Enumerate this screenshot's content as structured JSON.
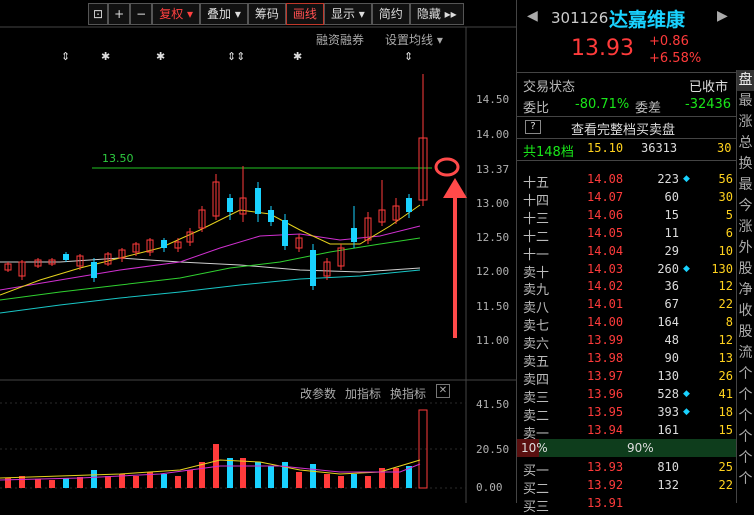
{
  "toolbar": {
    "buttons": [
      "复权",
      "叠加",
      "筹码",
      "画线",
      "显示",
      "简约",
      "隐藏"
    ],
    "collapse": "▸▸"
  },
  "chart_top": {
    "links": [
      "融资融券",
      "设置均线"
    ],
    "y_ticks": [
      "14.50",
      "14.00",
      "13.37",
      "13.00",
      "12.50",
      "12.00",
      "11.50",
      "11.00"
    ],
    "level_line_label": "13.50",
    "markers": [
      "⇕",
      "✱",
      "✱",
      "⇕⇕",
      "✱",
      "⇕"
    ]
  },
  "chart_bottom": {
    "links": [
      "改参数",
      "加指标",
      "换指标"
    ],
    "close_icon": "✕",
    "y_ticks": [
      "41.50",
      "20.50",
      "0.00"
    ]
  },
  "quote": {
    "code": "301126",
    "name": "达嘉维康",
    "price": "13.93",
    "change": "+0.86",
    "change_pct": "+6.58%",
    "status_label": "交易状态",
    "status_value": "已收市",
    "ratio_label": "委比",
    "ratio_value": "-80.71%",
    "diff_label": "委差",
    "diff_value": "-32436",
    "full_book_label": "查看完整档买卖盘",
    "total_label": "共148档",
    "total_price": "15.10",
    "total_vol": "36313",
    "total_count": "30",
    "split_left": "10%",
    "split_mid": "90%"
  },
  "asks": [
    {
      "label": "十五",
      "price": "14.08",
      "vol": "223",
      "mark": true,
      "count": "56"
    },
    {
      "label": "十四",
      "price": "14.07",
      "vol": "60",
      "mark": false,
      "count": "30"
    },
    {
      "label": "十三",
      "price": "14.06",
      "vol": "15",
      "mark": false,
      "count": "5"
    },
    {
      "label": "十二",
      "price": "14.05",
      "vol": "11",
      "mark": false,
      "count": "6"
    },
    {
      "label": "十一",
      "price": "14.04",
      "vol": "29",
      "mark": false,
      "count": "10"
    },
    {
      "label": "卖十",
      "price": "14.03",
      "vol": "260",
      "mark": true,
      "count": "130"
    },
    {
      "label": "卖九",
      "price": "14.02",
      "vol": "36",
      "mark": false,
      "count": "12"
    },
    {
      "label": "卖八",
      "price": "14.01",
      "vol": "67",
      "mark": false,
      "count": "22"
    },
    {
      "label": "卖七",
      "price": "14.00",
      "vol": "164",
      "mark": false,
      "count": "8"
    },
    {
      "label": "卖六",
      "price": "13.99",
      "vol": "48",
      "mark": false,
      "count": "12"
    },
    {
      "label": "卖五",
      "price": "13.98",
      "vol": "90",
      "mark": false,
      "count": "13"
    },
    {
      "label": "卖四",
      "price": "13.97",
      "vol": "130",
      "mark": false,
      "count": "26"
    },
    {
      "label": "卖三",
      "price": "13.96",
      "vol": "528",
      "mark": true,
      "count": "41"
    },
    {
      "label": "卖二",
      "price": "13.95",
      "vol": "393",
      "mark": true,
      "count": "18"
    },
    {
      "label": "卖一",
      "price": "13.94",
      "vol": "161",
      "mark": false,
      "count": "15"
    }
  ],
  "bids": [
    {
      "label": "买一",
      "price": "13.93",
      "vol": "810",
      "mark": false,
      "count": "25"
    },
    {
      "label": "买二",
      "price": "13.92",
      "vol": "132",
      "mark": false,
      "count": "22"
    },
    {
      "label": "买三",
      "price": "13.91",
      "vol": "",
      "mark": false,
      "count": ""
    }
  ],
  "side_strip": [
    "盘",
    "最",
    "涨",
    "总",
    "换",
    "最",
    "今",
    "涨",
    "外",
    "股",
    "净",
    "收",
    "股",
    "流",
    "个",
    "个",
    "个",
    "个",
    "个",
    "个"
  ],
  "colors": {
    "up": "#ff3b3b",
    "down": "#19e619",
    "accent": "#19d2ff",
    "level": "#22c522",
    "annotation": "#ff4a4a"
  }
}
